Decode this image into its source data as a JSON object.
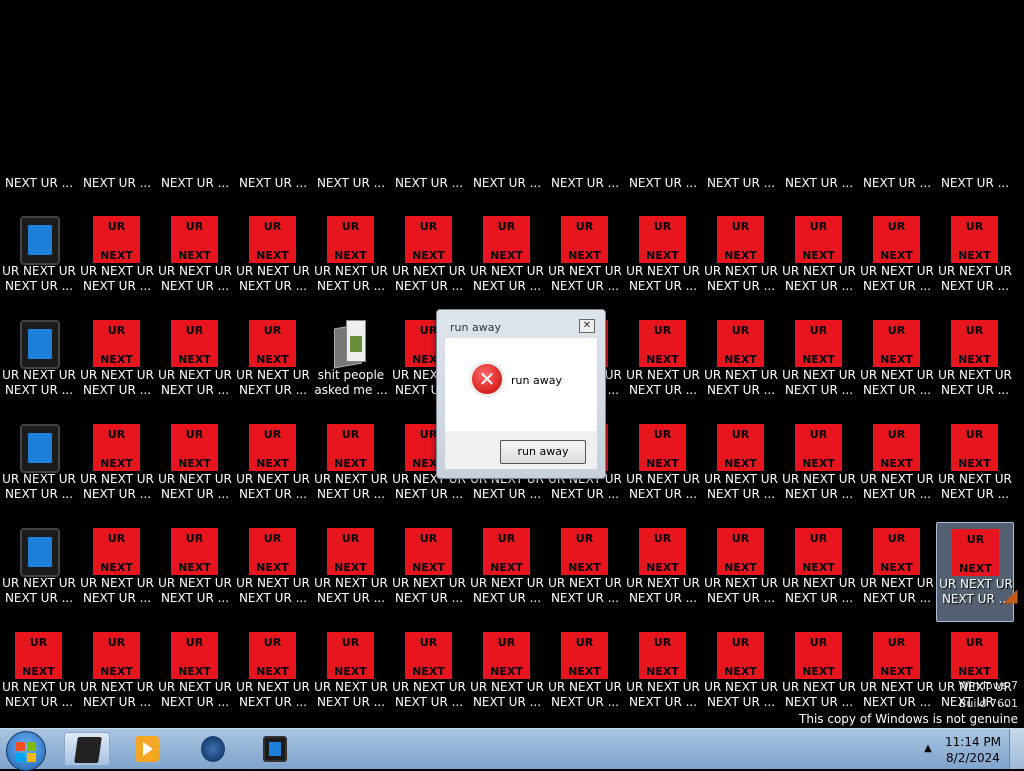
{
  "desktop": {
    "top_labels": [
      "NEXT UR ...",
      "NEXT UR ...",
      "NEXT UR ...",
      "NEXT UR ...",
      "NEXT UR ...",
      "NEXT UR ...",
      "NEXT UR ...",
      "NEXT UR ...",
      "NEXT UR ...",
      "NEXT UR ...",
      "NEXT UR ...",
      "NEXT UR ...",
      "NEXT UR ..."
    ],
    "icon_text_top": "UR",
    "icon_text_bottom": "NEXT",
    "icon_label": "UR NEXT UR\nNEXT UR ...",
    "folder_label": "shit people\nasked me ...",
    "accent": "#e8141e",
    "rows": [
      [
        "tablet",
        "red",
        "red",
        "red",
        "red",
        "red",
        "red",
        "red",
        "red",
        "red",
        "red",
        "red",
        "red"
      ],
      [
        "tablet",
        "red",
        "red",
        "red",
        "folder",
        "red",
        "red",
        "red",
        "red",
        "red",
        "red",
        "red",
        "red"
      ],
      [
        "tablet",
        "red",
        "red",
        "red",
        "red",
        "red",
        "red",
        "red",
        "red",
        "red",
        "red",
        "red",
        "red"
      ],
      [
        "tablet",
        "red",
        "red",
        "red",
        "red",
        "red",
        "red",
        "red",
        "red",
        "red",
        "red",
        "red",
        "red"
      ],
      [
        "red",
        "red",
        "red",
        "red",
        "red",
        "red",
        "red",
        "red",
        "red",
        "red",
        "red",
        "red",
        "red"
      ]
    ]
  },
  "dialog": {
    "title": "run away",
    "message": "run away",
    "button_label": "run away",
    "close_glyph": "✕",
    "icon": "error-icon"
  },
  "watermark": {
    "line1": "Windows 7",
    "line2": "Build 7601",
    "line3": "This copy of Windows is not genuine"
  },
  "taskbar": {
    "items": [
      "terminal-icon",
      "media-player-icon",
      "firefox-icon",
      "tablet-app-icon"
    ],
    "time": "11:14 PM",
    "date": "8/2/2024",
    "tray_arrow": "▲"
  }
}
